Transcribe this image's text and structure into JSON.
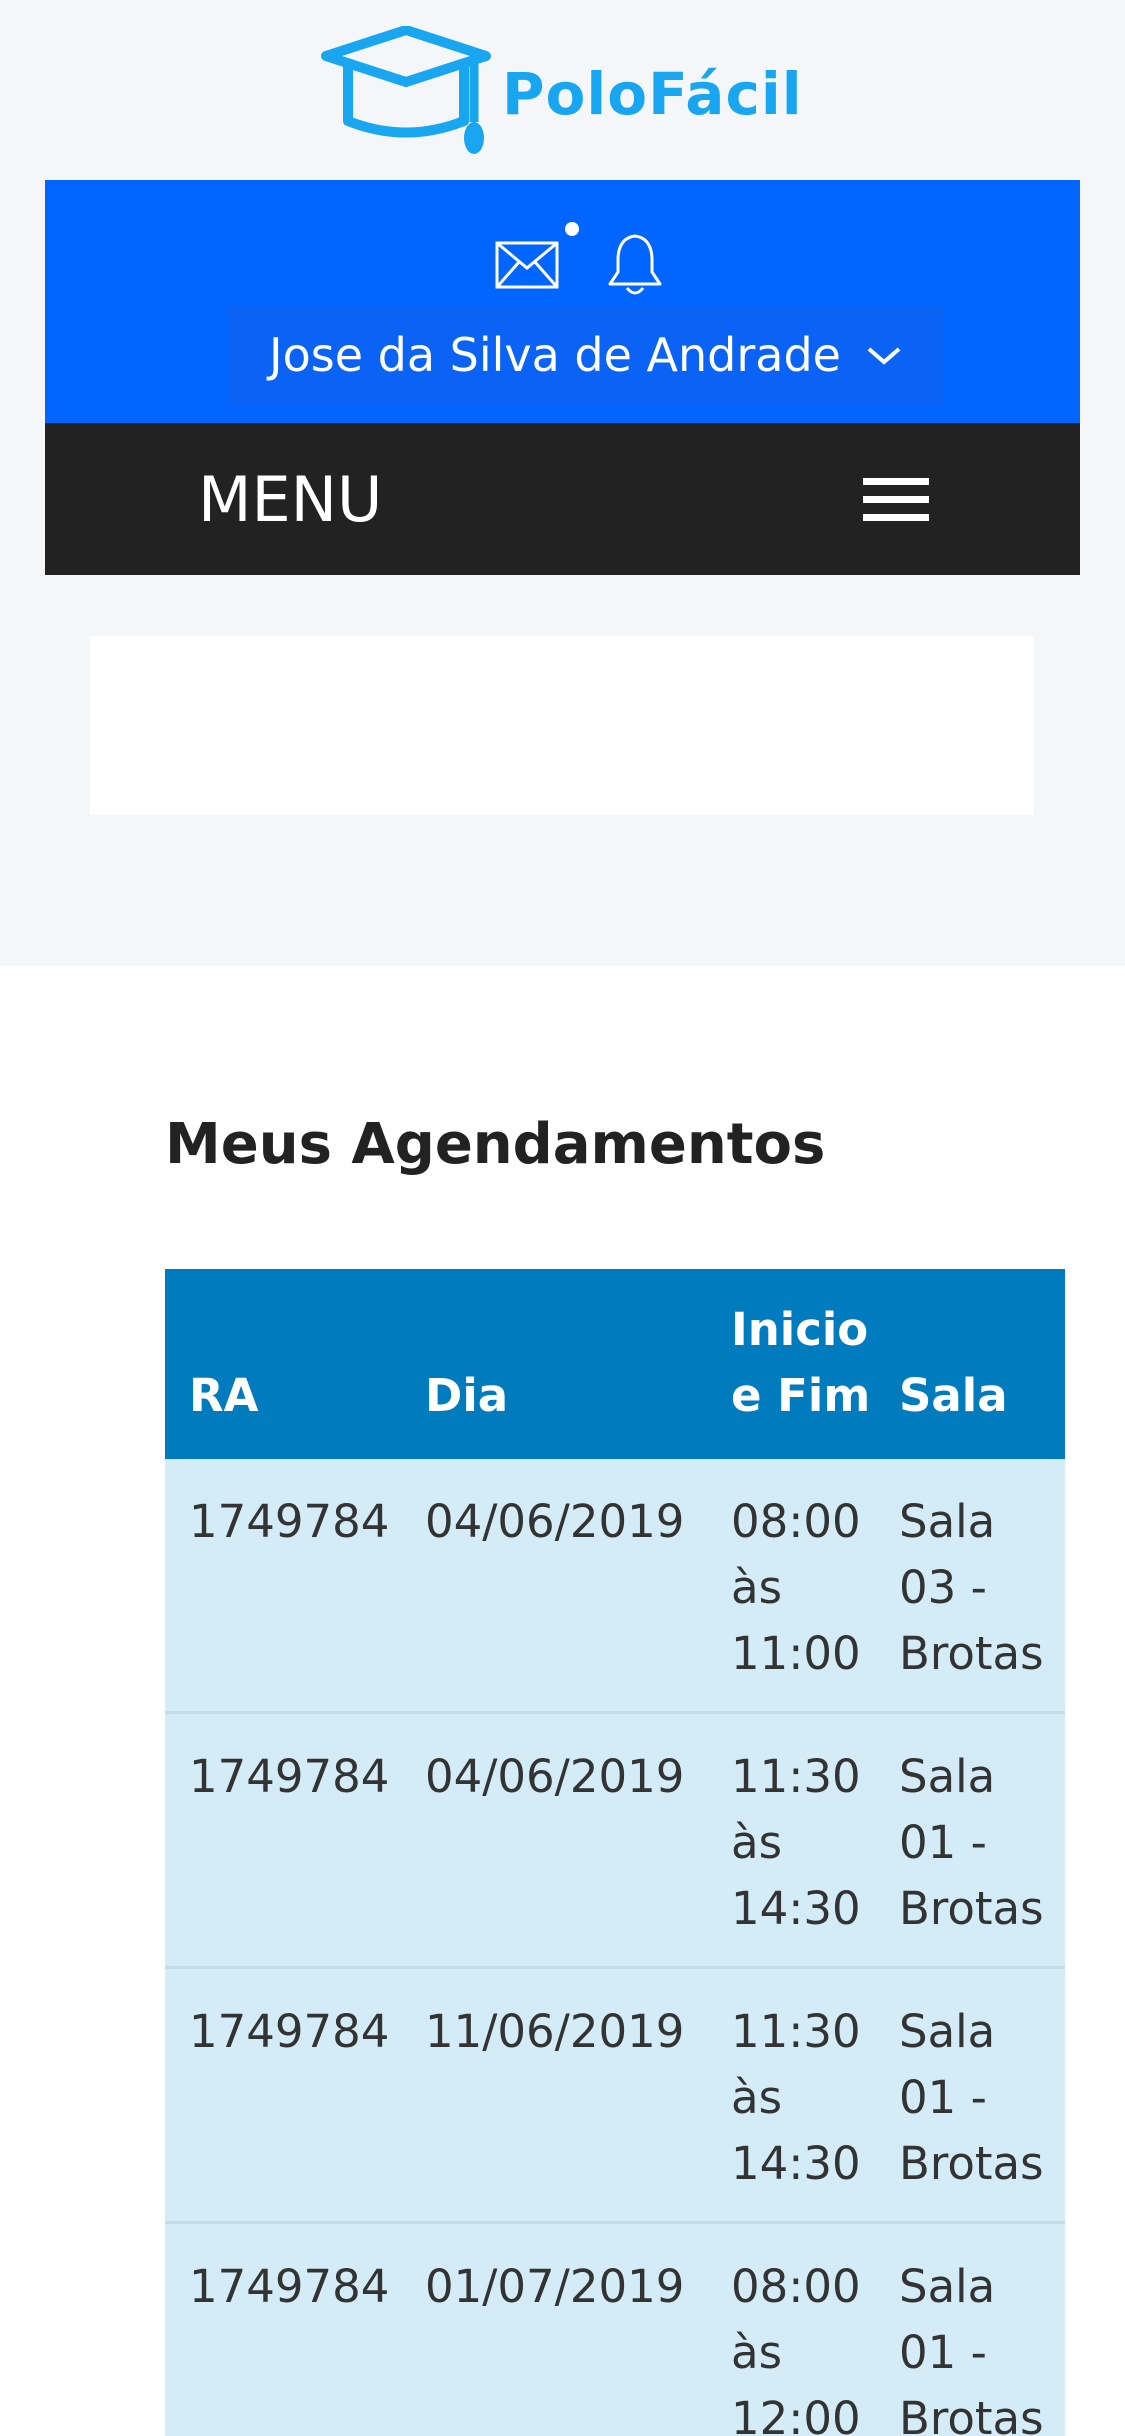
{
  "brand": {
    "name": "PoloFácil",
    "logo_icon": "graduation-cap-icon",
    "color": "#19a6f0"
  },
  "header": {
    "background": "#0066ff",
    "mail_icon": "envelope-icon",
    "bell_icon": "bell-icon",
    "user_name": "Jose da Silva de Andrade",
    "dropdown_icon": "chevron-down-icon"
  },
  "menu": {
    "label": "MENU",
    "toggle_icon": "hamburger-icon"
  },
  "section": {
    "title": "Meus Agendamentos"
  },
  "table": {
    "headers": {
      "ra": "RA",
      "dia": "Dia",
      "inicio_fim_line1": "Inicio",
      "inicio_fim_line2": "e Fim",
      "sala": "Sala"
    },
    "rows": [
      {
        "ra": "1749784",
        "dia": "04/06/2019",
        "hora": [
          "08:00",
          "às",
          "11:00"
        ],
        "sala": [
          "Sala",
          "03 -",
          "Brotas"
        ]
      },
      {
        "ra": "1749784",
        "dia": "04/06/2019",
        "hora": [
          "11:30",
          "às",
          "14:30"
        ],
        "sala": [
          "Sala",
          "01 -",
          "Brotas"
        ]
      },
      {
        "ra": "1749784",
        "dia": "11/06/2019",
        "hora": [
          "11:30",
          "às",
          "14:30"
        ],
        "sala": [
          "Sala",
          "01 -",
          "Brotas"
        ]
      },
      {
        "ra": "1749784",
        "dia": "01/07/2019",
        "hora": [
          "08:00",
          "às",
          "12:00"
        ],
        "sala": [
          "Sala",
          "01 -",
          "Brotas"
        ]
      }
    ]
  }
}
